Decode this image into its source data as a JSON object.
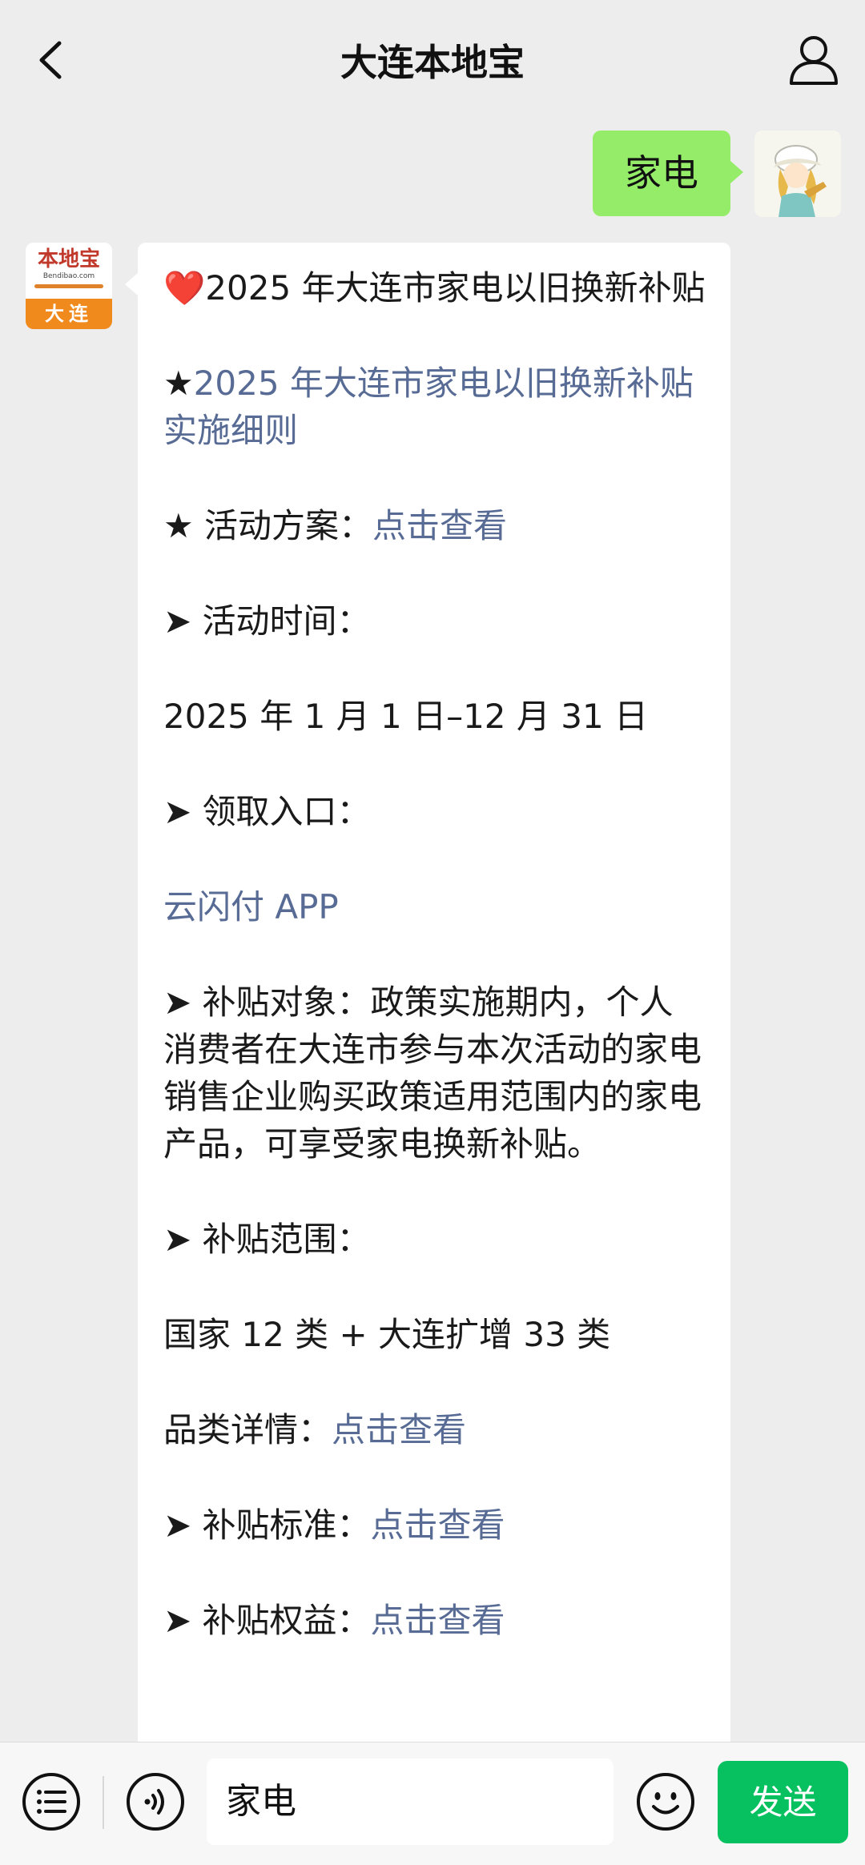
{
  "header": {
    "title": "大连本地宝",
    "back_icon": "chevron-left-icon",
    "profile_icon": "person-icon"
  },
  "outgoing": {
    "text": "家电"
  },
  "bot": {
    "avatar_cn": "本地宝",
    "avatar_url": "Bendibao.com",
    "avatar_city": "大连"
  },
  "message": {
    "title_heart": "❤️",
    "title": "2025 年大连市家电以旧换新补贴",
    "detail_star": "★",
    "detail_link": "2025 年大连市家电以旧换新补贴实施细则",
    "plan_label": "★ 活动方案：",
    "plan_link": "点击查看",
    "time_label": "➤ 活动时间：",
    "time_value": "2025 年 1 月 1 日–12 月 31 日",
    "entry_label": "➤ 领取入口：",
    "entry_link": "云闪付 APP",
    "target_text": "➤ 补贴对象：政策实施期内，个人消费者在大连市参与本次活动的家电销售企业购买政策适用范围内的家电产品，可享受家电换新补贴。",
    "scope_label": "➤ 补贴范围：",
    "scope_value": "国家 12 类 + 大连扩增 33 类",
    "category_label": "品类详情：",
    "category_link": "点击查看",
    "standard_label": "➤ 补贴标准：",
    "standard_link": "点击查看",
    "rights_label": "➤ 补贴权益：",
    "rights_link": "点击查看"
  },
  "input_bar": {
    "value": "家电",
    "send_label": "发送",
    "menu_icon": "list-menu-icon",
    "voice_icon": "voice-icon",
    "emoji_icon": "emoji-icon"
  },
  "colors": {
    "background": "#ededed",
    "outgoing_bubble": "#95ec69",
    "link": "#576b95",
    "send_button": "#07c160"
  }
}
